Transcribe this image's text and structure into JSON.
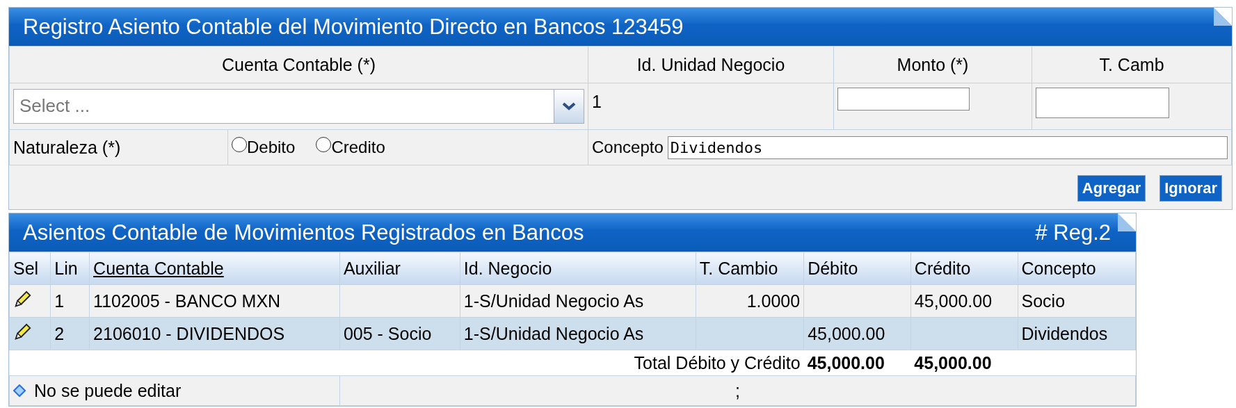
{
  "form_panel": {
    "title": "Registro Asiento Contable del Movimiento Directo en Bancos 123459",
    "headers": [
      "Cuenta Contable (*)",
      "Id. Unidad Negocio",
      "Monto (*)",
      "T. Camb"
    ],
    "account_select": {
      "placeholder": "Select ..."
    },
    "business_unit": "1",
    "nature_label": "Naturaleza (*)",
    "nature_options": [
      {
        "label": "Debito",
        "selected": false
      },
      {
        "label": "Credito",
        "selected": false
      }
    ],
    "concept_label": "Concepto",
    "concept_field": {
      "value": "Dividendos"
    },
    "buttons": [
      "Agregar",
      "Ignorar"
    ]
  },
  "entries_panel": {
    "title": "Asientos Contable de Movimientos Registrados en Bancos",
    "count": "# Reg.2",
    "columns": [
      {
        "label": "Sel",
        "sortable": false
      },
      {
        "label": "Lin",
        "sortable": false
      },
      {
        "label": "Cuenta Contable",
        "sortable": true
      },
      {
        "label": "Auxiliar",
        "sortable": false
      },
      {
        "label": "Id. Negocio",
        "sortable": false
      },
      {
        "label": "T. Cambio",
        "sortable": false
      },
      {
        "label": "Débito",
        "sortable": false
      },
      {
        "label": "Crédito",
        "sortable": false
      },
      {
        "label": "Concepto",
        "sortable": false
      }
    ],
    "rows": [
      {
        "line": "1",
        "account": "1102005 - BANCO MXN",
        "auxiliary": "",
        "business": "1-S/Unidad Negocio As",
        "rate": "1.0000",
        "debit": "",
        "credit": "45,000.00",
        "concept": "Socio"
      },
      {
        "line": "2",
        "account": "2106010 - DIVIDENDOS",
        "auxiliary": "005 - Socio",
        "business": "1-S/Unidad Negocio As",
        "rate": "",
        "debit": "45,000.00",
        "credit": "",
        "concept": "Dividendos"
      }
    ],
    "total_label": "Total Débito y Crédito",
    "total_debit": "45,000.00",
    "total_credit": "45,000.00",
    "footer_note": "No se puede editar",
    "footer_value": ";"
  }
}
